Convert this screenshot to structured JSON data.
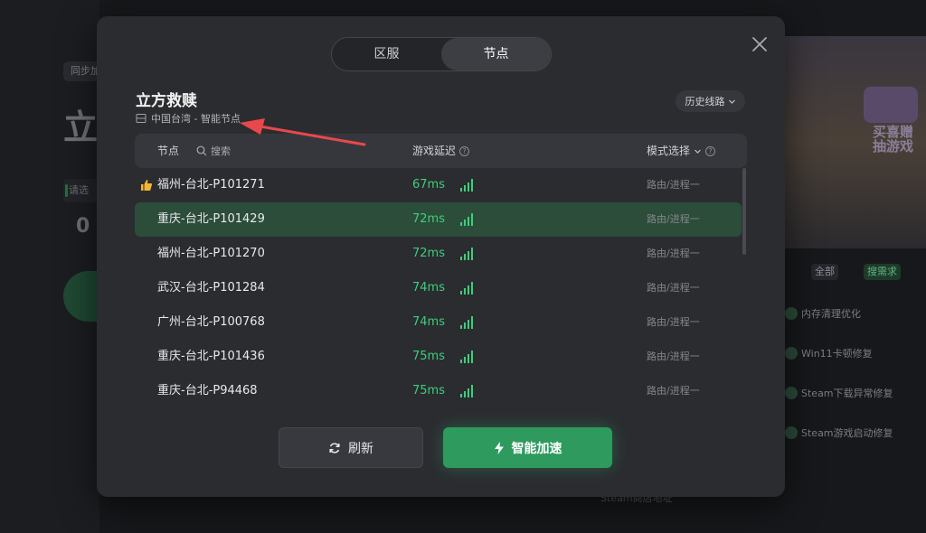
{
  "background": {
    "chip_label": "同步加",
    "big_text": "立",
    "select_label": "请选",
    "zero_text": "0",
    "banner_text": "买喜赠\n抽游戏",
    "tags": {
      "all": "全部",
      "search": "搜需求"
    },
    "tools": [
      "内存清理优化",
      "Win11卡顿修复",
      "Steam下载异常修复",
      "Steam游戏启动修复"
    ],
    "bottom_text": "Steam商店地址"
  },
  "modal": {
    "tabs": [
      {
        "label": "区服",
        "active": false
      },
      {
        "label": "节点",
        "active": true
      }
    ],
    "game_title": "立方救赎",
    "region_text": "中国台湾 - 智能节点",
    "history_label": "历史线路",
    "table": {
      "col_node": "节点",
      "search_placeholder": "搜索",
      "col_latency": "游戏延迟",
      "col_mode": "模式选择"
    },
    "rows": [
      {
        "node": "福州-台北-P101271",
        "latency": "67ms",
        "mode": "路由/进程一",
        "recommended": true,
        "selected": false
      },
      {
        "node": "重庆-台北-P101429",
        "latency": "72ms",
        "mode": "路由/进程一",
        "recommended": false,
        "selected": true
      },
      {
        "node": "福州-台北-P101270",
        "latency": "72ms",
        "mode": "路由/进程一",
        "recommended": false,
        "selected": false
      },
      {
        "node": "武汉-台北-P101284",
        "latency": "74ms",
        "mode": "路由/进程一",
        "recommended": false,
        "selected": false
      },
      {
        "node": "广州-台北-P100768",
        "latency": "74ms",
        "mode": "路由/进程一",
        "recommended": false,
        "selected": false
      },
      {
        "node": "重庆-台北-P101436",
        "latency": "75ms",
        "mode": "路由/进程一",
        "recommended": false,
        "selected": false
      },
      {
        "node": "重庆-台北-P94468",
        "latency": "75ms",
        "mode": "路由/进程一",
        "recommended": false,
        "selected": false
      }
    ],
    "refresh_label": "刷新",
    "accelerate_label": "智能加速"
  },
  "colors": {
    "accent_green": "#2e9a5e",
    "latency_green": "#3ccf7a",
    "annotation_red": "#e8484b"
  },
  "icons": [
    "close-icon",
    "server-icon",
    "chevron-down-icon",
    "search-icon",
    "help-icon",
    "thumbs-up-icon",
    "signal-bars-icon",
    "refresh-icon",
    "lightning-icon"
  ]
}
